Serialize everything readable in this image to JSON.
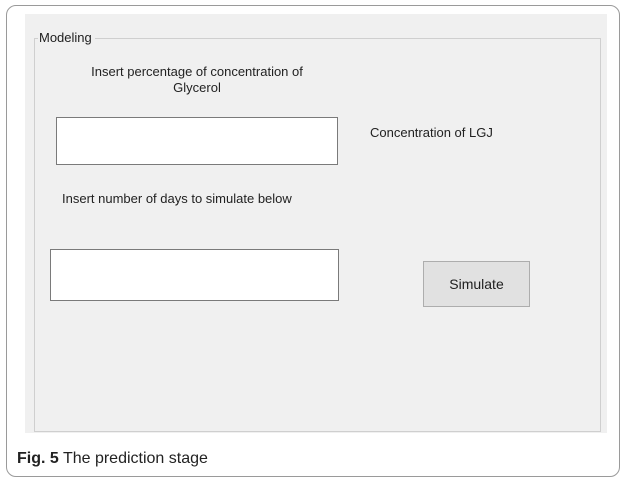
{
  "group": {
    "title": "Modeling"
  },
  "glycerol": {
    "label_line1": "Insert percentage of concentration of",
    "label_line2": "Glycerol",
    "value": ""
  },
  "output": {
    "label": "Concentration of LGJ"
  },
  "days": {
    "label": "Insert number of days to simulate below",
    "value": ""
  },
  "actions": {
    "simulate_label": "Simulate"
  },
  "caption": {
    "number": "Fig. 5",
    "text": "The prediction stage"
  },
  "colors": {
    "panel_background": "#f0f0f0",
    "button_face": "#e1e1e1",
    "textbox_border": "#7a7a7a"
  }
}
